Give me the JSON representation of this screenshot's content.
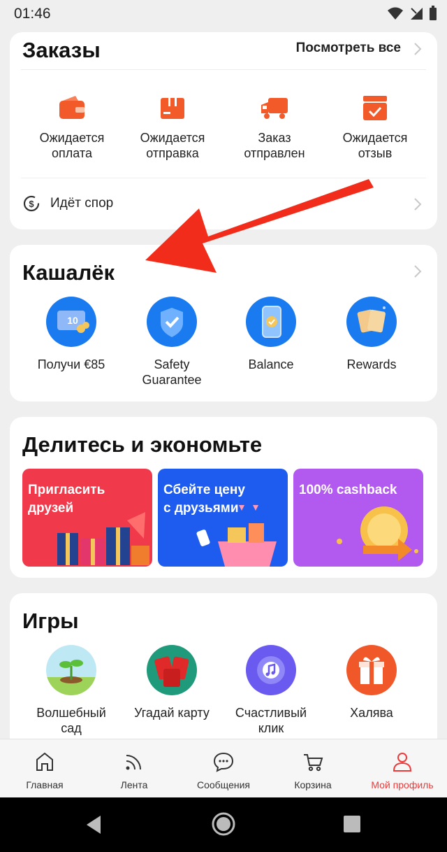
{
  "status_bar": {
    "time": "01:46"
  },
  "orders": {
    "title": "Заказы",
    "see_all": "Посмотреть все",
    "items": [
      {
        "label": "Ожидается\nоплата",
        "icon": "wallet-icon"
      },
      {
        "label": "Ожидается\nотправка",
        "icon": "package-icon"
      },
      {
        "label": "Заказ\nотправлен",
        "icon": "truck-icon"
      },
      {
        "label": "Ожидается\nотзыв",
        "icon": "review-check-icon"
      }
    ],
    "dispute": {
      "label": "Идёт спор",
      "icon": "dollar-refresh-icon"
    }
  },
  "wallet": {
    "title": "Кашалёк",
    "items": [
      {
        "label": "Получи €85",
        "icon": "coupon-icon",
        "coupon_value": "10"
      },
      {
        "label": "Safety\nGuarantee",
        "icon": "shield-check-icon"
      },
      {
        "label": "Balance",
        "icon": "phone-coin-icon"
      },
      {
        "label": "Rewards",
        "icon": "reward-cards-icon"
      }
    ]
  },
  "share": {
    "title": "Делитесь и экономьте",
    "promos": [
      {
        "label": "Пригласить\nдрузей",
        "color": "#f0394a"
      },
      {
        "label": "Сбейте цену\nс друзьями",
        "color": "#1e5cf0"
      },
      {
        "label": "100% cashback",
        "color": "#b25af0"
      }
    ]
  },
  "games": {
    "title": "Игры",
    "items": [
      {
        "label": "Волшебный\nсад",
        "icon": "sprout-icon"
      },
      {
        "label": "Угадай карту",
        "icon": "cards-icon"
      },
      {
        "label": "Счастливый\nклик",
        "icon": "music-note-icon"
      },
      {
        "label": "Халява",
        "icon": "gift-icon"
      }
    ]
  },
  "bottom_nav": [
    {
      "label": "Главная",
      "icon": "home-icon"
    },
    {
      "label": "Лента",
      "icon": "feed-icon"
    },
    {
      "label": "Сообщения",
      "icon": "chat-icon"
    },
    {
      "label": "Корзина",
      "icon": "cart-icon"
    },
    {
      "label": "Мой профиль",
      "icon": "profile-icon",
      "active": true
    }
  ],
  "colors": {
    "accent": "#ec3b3b",
    "icon_orange": "#f25a2a",
    "wallet_blue": "#1a7af0"
  }
}
